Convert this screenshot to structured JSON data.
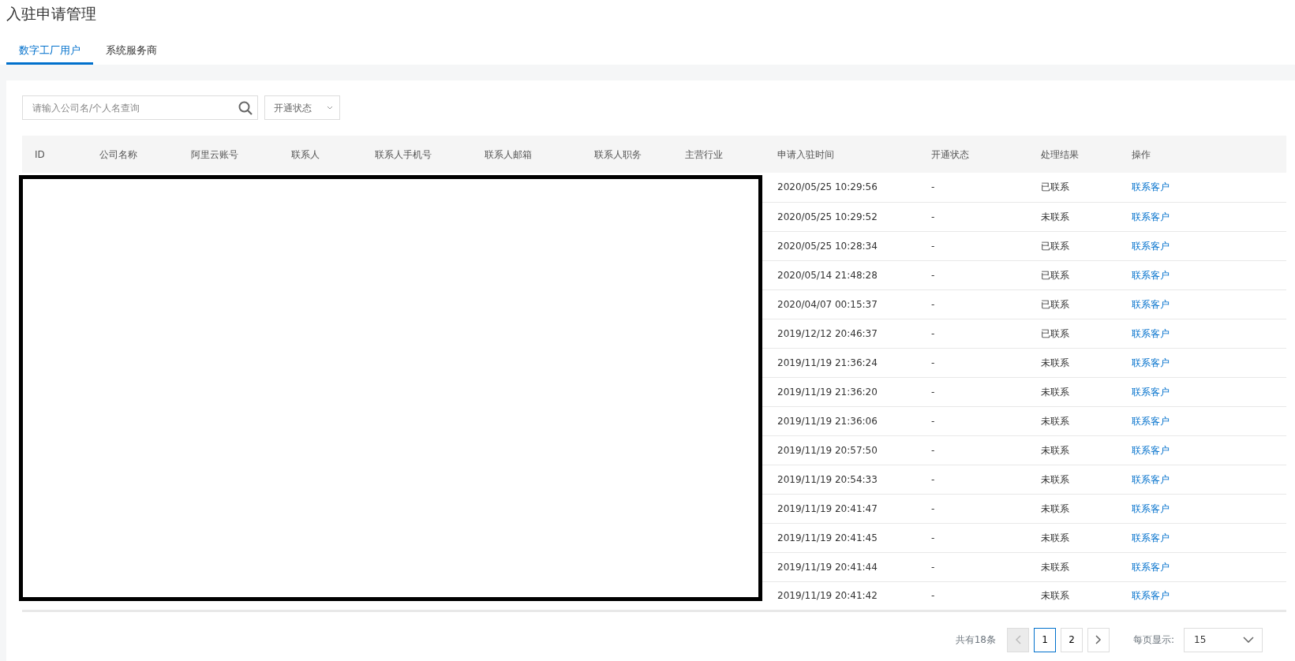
{
  "page_title": "入驻申请管理",
  "tabs": [
    {
      "label": "数字工厂用户",
      "selected": true
    },
    {
      "label": "系统服务商",
      "selected": false
    }
  ],
  "search": {
    "placeholder": "请输入公司名/个人名查询"
  },
  "status_filter": {
    "label": "开通状态"
  },
  "table": {
    "columns": [
      "ID",
      "公司名称",
      "阿里云账号",
      "联系人",
      "联系人手机号",
      "联系人邮箱",
      "联系人职务",
      "主营行业",
      "申请入驻时间",
      "开通状态",
      "处理结果",
      "操作"
    ],
    "rows": [
      {
        "time": "2020/05/25 10:29:56",
        "status": "-",
        "result": "已联系",
        "action": "联系客户"
      },
      {
        "time": "2020/05/25 10:29:52",
        "status": "-",
        "result": "未联系",
        "action": "联系客户"
      },
      {
        "time": "2020/05/25 10:28:34",
        "status": "-",
        "result": "已联系",
        "action": "联系客户"
      },
      {
        "time": "2020/05/14 21:48:28",
        "status": "-",
        "result": "已联系",
        "action": "联系客户"
      },
      {
        "time": "2020/04/07 00:15:37",
        "status": "-",
        "result": "已联系",
        "action": "联系客户"
      },
      {
        "time": "2019/12/12 20:46:37",
        "status": "-",
        "result": "已联系",
        "action": "联系客户"
      },
      {
        "time": "2019/11/19 21:36:24",
        "status": "-",
        "result": "未联系",
        "action": "联系客户"
      },
      {
        "time": "2019/11/19 21:36:20",
        "status": "-",
        "result": "未联系",
        "action": "联系客户"
      },
      {
        "time": "2019/11/19 21:36:06",
        "status": "-",
        "result": "未联系",
        "action": "联系客户"
      },
      {
        "time": "2019/11/19 20:57:50",
        "status": "-",
        "result": "未联系",
        "action": "联系客户"
      },
      {
        "time": "2019/11/19 20:54:33",
        "status": "-",
        "result": "未联系",
        "action": "联系客户"
      },
      {
        "time": "2019/11/19 20:41:47",
        "status": "-",
        "result": "未联系",
        "action": "联系客户"
      },
      {
        "time": "2019/11/19 20:41:45",
        "status": "-",
        "result": "未联系",
        "action": "联系客户"
      },
      {
        "time": "2019/11/19 20:41:44",
        "status": "-",
        "result": "未联系",
        "action": "联系客户"
      },
      {
        "time": "2019/11/19 20:41:42",
        "status": "-",
        "result": "未联系",
        "action": "联系客户"
      }
    ]
  },
  "pagination": {
    "total": "共有18条",
    "pages": [
      {
        "label": "1",
        "selected": true
      },
      {
        "label": "2",
        "selected": false
      }
    ],
    "page_size_label": "每页显示:",
    "page_size": "15"
  }
}
